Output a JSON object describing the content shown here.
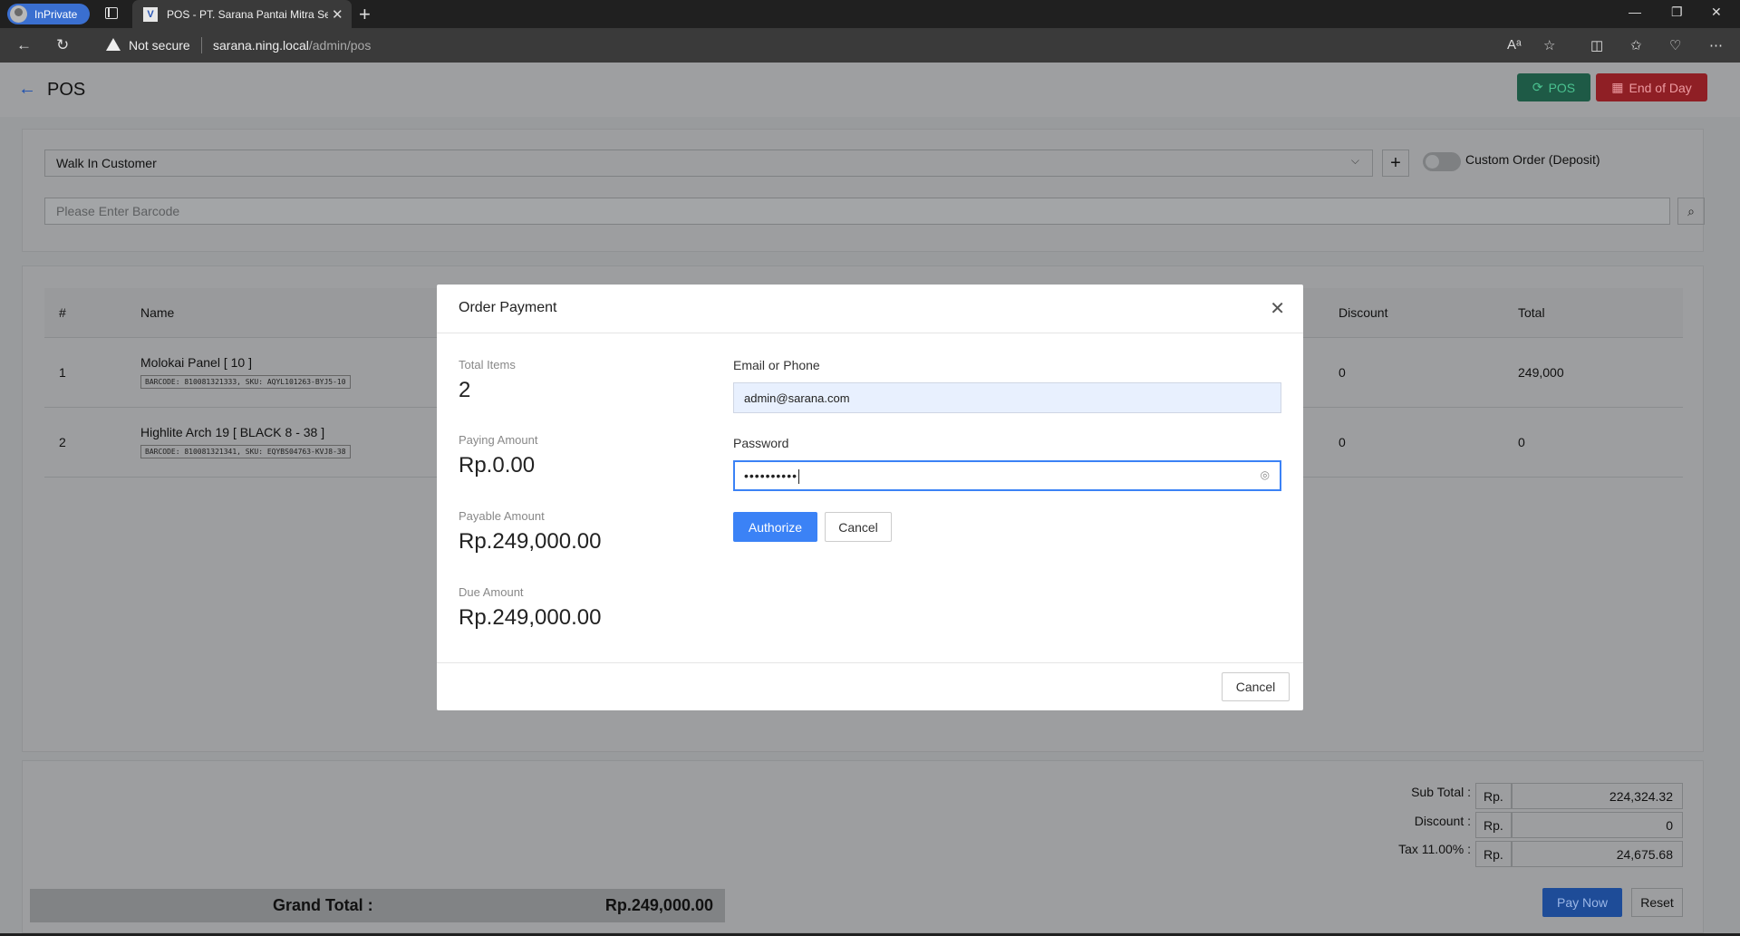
{
  "browser": {
    "inprivate_label": "InPrivate",
    "tab_title": "POS - PT. Sarana Pantai Mitra Se",
    "security_label": "Not secure",
    "url_host": "sarana.ning.local",
    "url_path": "/admin/pos"
  },
  "header": {
    "title": "POS",
    "pos_button": "POS",
    "end_of_day_button": "End of Day"
  },
  "customer": {
    "selected": "Walk In Customer",
    "custom_order_label": "Custom Order (Deposit)",
    "barcode_placeholder": "Please Enter Barcode"
  },
  "table": {
    "columns": {
      "num": "#",
      "name": "Name",
      "discount": "Discount",
      "total": "Total"
    },
    "rows": [
      {
        "num": "1",
        "name": "Molokai Panel [ 10 ]",
        "meta": "BARCODE: 810081321333, SKU: AQYL101263-BYJ5-10",
        "discount": "0",
        "total": "249,000"
      },
      {
        "num": "2",
        "name": "Highlite Arch 19 [ BLACK 8 - 38 ]",
        "meta": "BARCODE: 810081321341, SKU: EQYBS04763-KVJ8-38",
        "discount": "0",
        "total": "0"
      }
    ]
  },
  "summary": {
    "subtotal_label": "Sub Total :",
    "discount_label": "Discount :",
    "tax_label": "Tax 11.00% :",
    "currency": "Rp.",
    "subtotal": "224,324.32",
    "discount": "0",
    "tax": "24,675.68",
    "grand_total_label": "Grand Total :",
    "grand_total": "Rp.249,000.00",
    "pay_now": "Pay Now",
    "reset": "Reset"
  },
  "modal": {
    "title": "Order Payment",
    "total_items_label": "Total Items",
    "total_items": "2",
    "paying_amount_label": "Paying Amount",
    "paying_amount": "Rp.0.00",
    "payable_amount_label": "Payable Amount",
    "payable_amount": "Rp.249,000.00",
    "due_amount_label": "Due Amount",
    "due_amount": "Rp.249,000.00",
    "email_label": "Email or Phone",
    "email_value": "admin@sarana.com",
    "password_label": "Password",
    "password_masked": "••••••••••",
    "authorize": "Authorize",
    "cancel": "Cancel",
    "footer_cancel": "Cancel"
  }
}
